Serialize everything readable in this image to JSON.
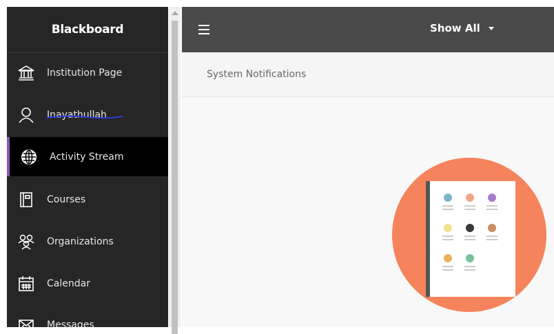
{
  "sidebar": {
    "brand": "Blackboard",
    "items": [
      {
        "label": "Institution Page",
        "icon": "institution-icon"
      },
      {
        "label": "Inayathullah",
        "icon": "user-icon"
      },
      {
        "label": "Activity Stream",
        "icon": "globe-icon",
        "active": true
      },
      {
        "label": "Courses",
        "icon": "courses-icon"
      },
      {
        "label": "Organizations",
        "icon": "organizations-icon"
      },
      {
        "label": "Calendar",
        "icon": "calendar-icon"
      },
      {
        "label": "Messages",
        "icon": "envelope-icon"
      }
    ],
    "accent_color": "#8a5bb5"
  },
  "topbar": {
    "filter_label": "Show All"
  },
  "notifications": {
    "label": "System Notifications"
  },
  "colors": {
    "sidebar_bg": "#262626",
    "topbar_bg": "#4a4a4a",
    "illustration_circle": "#f5845c"
  }
}
